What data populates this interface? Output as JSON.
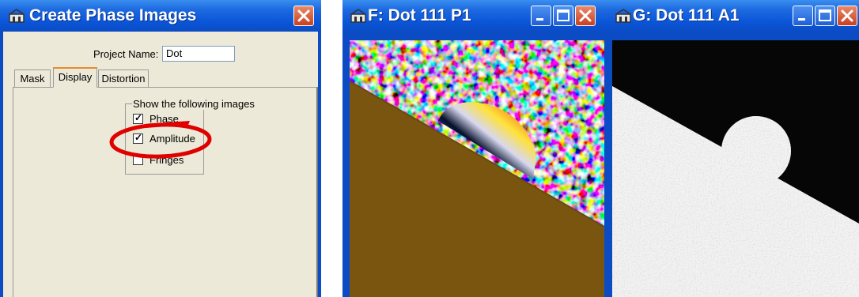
{
  "dialog": {
    "title": "Create Phase Images",
    "project_name_label": "Project Name:",
    "project_name_value": "Dot",
    "tabs": [
      {
        "label": "Mask",
        "active": false
      },
      {
        "label": "Display",
        "active": true
      },
      {
        "label": "Distortion",
        "active": false
      }
    ],
    "group_title": "Show the following images",
    "options": [
      {
        "label": "Phase",
        "checked": true
      },
      {
        "label": "Amplitude",
        "checked": true
      },
      {
        "label": "Fringes",
        "checked": false
      }
    ],
    "annotation_color": "#e00000"
  },
  "window_f": {
    "title": "F: Dot 111 P1"
  },
  "window_g": {
    "title": "G: Dot 111 A1"
  },
  "colors": {
    "titlebar": "#0a55d8",
    "close_button": "#c8401f",
    "dialog_bg": "#ece9d8",
    "sand": "#7a5510"
  },
  "icons": [
    "app-icon",
    "minimize-icon",
    "maximize-icon",
    "close-icon",
    "check-icon"
  ]
}
